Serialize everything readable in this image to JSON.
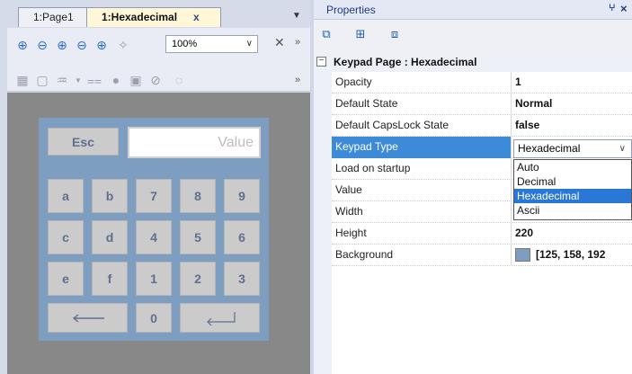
{
  "editor": {
    "tabs": [
      {
        "label": "1:Page1"
      },
      {
        "label": "1:Hexadecimal",
        "close": "x"
      }
    ],
    "zoom": {
      "value": "100%"
    },
    "canvas_color": "#888888"
  },
  "keypad": {
    "background": "#7d9ec0",
    "esc": "Esc",
    "value_placeholder": "Value",
    "keys": [
      "a",
      "b",
      "7",
      "8",
      "9",
      "c",
      "d",
      "4",
      "5",
      "6",
      "e",
      "f",
      "1",
      "2",
      "3"
    ],
    "zero": "0",
    "backspace_icon": "left-arrow-icon",
    "enter_icon": "enter-icon"
  },
  "properties": {
    "title": "Properties",
    "category": "Keypad Page : Hexadecimal",
    "rows": [
      {
        "name": "Opacity",
        "value": "1"
      },
      {
        "name": "Default State",
        "value": "Normal"
      },
      {
        "name": "Default CapsLock State",
        "value": "false"
      },
      {
        "name": "Keypad Type",
        "value": "Hexadecimal"
      },
      {
        "name": "Load on startup",
        "value": ""
      },
      {
        "name": "Value",
        "value": ""
      },
      {
        "name": "Width",
        "value": ""
      },
      {
        "name": "Height",
        "value": "220"
      },
      {
        "name": "Background",
        "value": "[125, 158, 192"
      }
    ],
    "background_swatch": "#7d9ec0",
    "keypad_type_options": [
      "Auto",
      "Decimal",
      "Hexadecimal",
      "Ascii"
    ],
    "keypad_type_selected": "Hexadecimal"
  },
  "colors": {
    "selection": "#3d8bd8",
    "dropdown_highlight": "#2a78d6"
  }
}
